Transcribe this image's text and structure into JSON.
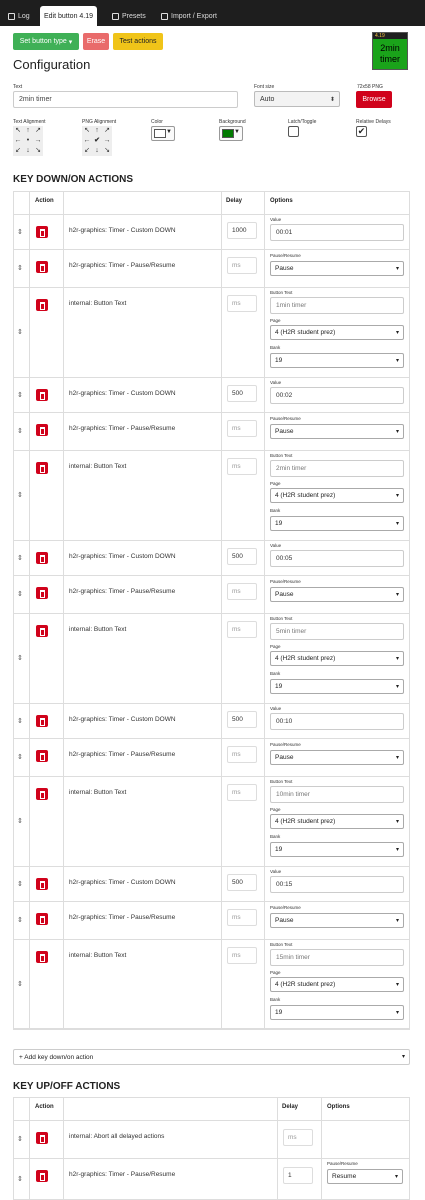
{
  "tabs": [
    {
      "label": "Log"
    },
    {
      "label": "Edit button 4.19"
    },
    {
      "label": "Presets"
    },
    {
      "label": "Import / Export"
    }
  ],
  "toolbar": {
    "set_type": "Set button type",
    "erase": "Erase",
    "test": "Test actions"
  },
  "preview": {
    "page_bank": "4.19",
    "text": "2min timer",
    "bg_color": "#1aa31a"
  },
  "config": {
    "title": "Configuration",
    "text_label": "Text",
    "text_value": "2min timer",
    "font_label": "Font size",
    "font_value": "Auto",
    "png_label": "72x58 PNG",
    "browse": "Browse",
    "text_align_label": "Text Alignment",
    "png_align_label": "PNG Alignment",
    "color_label": "Color",
    "bg_label": "Background",
    "latch_label": "Latch/Toggle",
    "relative_label": "Relative Delays",
    "relative_checked": "✔"
  },
  "down": {
    "title": "KEY DOWN/ON ACTIONS",
    "headers": {
      "action": "Action",
      "delay": "Delay",
      "options": "Options"
    },
    "add": "+ Add key down/on action",
    "rows": [
      {
        "name": "h2r-graphics: Timer - Custom DOWN",
        "delay": "1000",
        "opt_label": "Value",
        "opt_value": "00:01"
      },
      {
        "name": "h2r-graphics: Timer - Pause/Resume",
        "delay": "ms",
        "opt_label": "Pause/Resume",
        "opt_value": "Pause"
      },
      {
        "name": "internal: Button Text",
        "delay": "ms",
        "bt_label": "Button Text",
        "bt_value": "1min timer",
        "page_label": "Page",
        "page_value": "4 (H2R student prez)",
        "bank_label": "Bank",
        "bank_value": "19"
      },
      {
        "name": "h2r-graphics: Timer - Custom DOWN",
        "delay": "500",
        "opt_label": "Value",
        "opt_value": "00:02"
      },
      {
        "name": "h2r-graphics: Timer - Pause/Resume",
        "delay": "ms",
        "opt_label": "Pause/Resume",
        "opt_value": "Pause"
      },
      {
        "name": "internal: Button Text",
        "delay": "ms",
        "bt_label": "Button Text",
        "bt_value": "2min timer",
        "page_label": "Page",
        "page_value": "4 (H2R student prez)",
        "bank_label": "Bank",
        "bank_value": "19"
      },
      {
        "name": "h2r-graphics: Timer - Custom DOWN",
        "delay": "500",
        "opt_label": "Value",
        "opt_value": "00:05"
      },
      {
        "name": "h2r-graphics: Timer - Pause/Resume",
        "delay": "ms",
        "opt_label": "Pause/Resume",
        "opt_value": "Pause"
      },
      {
        "name": "internal: Button Text",
        "delay": "ms",
        "bt_label": "Button Text",
        "bt_value": "5min timer",
        "page_label": "Page",
        "page_value": "4 (H2R student prez)",
        "bank_label": "Bank",
        "bank_value": "19"
      },
      {
        "name": "h2r-graphics: Timer - Custom DOWN",
        "delay": "500",
        "opt_label": "Value",
        "opt_value": "00:10"
      },
      {
        "name": "h2r-graphics: Timer - Pause/Resume",
        "delay": "ms",
        "opt_label": "Pause/Resume",
        "opt_value": "Pause"
      },
      {
        "name": "internal: Button Text",
        "delay": "ms",
        "bt_label": "Button Text",
        "bt_value": "10min timer",
        "page_label": "Page",
        "page_value": "4 (H2R student prez)",
        "bank_label": "Bank",
        "bank_value": "19"
      },
      {
        "name": "h2r-graphics: Timer - Custom DOWN",
        "delay": "500",
        "opt_label": "Value",
        "opt_value": "00:15"
      },
      {
        "name": "h2r-graphics: Timer - Pause/Resume",
        "delay": "ms",
        "opt_label": "Pause/Resume",
        "opt_value": "Pause"
      },
      {
        "name": "internal: Button Text",
        "delay": "ms",
        "bt_label": "Button Text",
        "bt_value": "15min timer",
        "page_label": "Page",
        "page_value": "4 (H2R student prez)",
        "bank_label": "Bank",
        "bank_value": "19"
      }
    ]
  },
  "up": {
    "title": "KEY UP/OFF ACTIONS",
    "headers": {
      "action": "Action",
      "delay": "Delay",
      "options": "Options"
    },
    "rows": [
      {
        "name": "internal: Abort all delayed actions",
        "delay": "ms"
      },
      {
        "name": "h2r-graphics: Timer - Pause/Resume",
        "delay": "1",
        "opt_label": "Pause/Resume",
        "opt_value": "Resume"
      }
    ]
  },
  "icons": {
    "drag": "⇕",
    "dropdown": "▾",
    "align": [
      "↖",
      "↑",
      "↗",
      "←",
      "•",
      "→",
      "↙",
      "↓",
      "↘"
    ],
    "png_align_selected": "✔"
  },
  "colors": {
    "accent_green": "#3fb056",
    "danger": "#d0021b",
    "warning": "#f0c419",
    "text_color_swatch": "#ffffff",
    "bg_color_swatch": "#007a00"
  }
}
